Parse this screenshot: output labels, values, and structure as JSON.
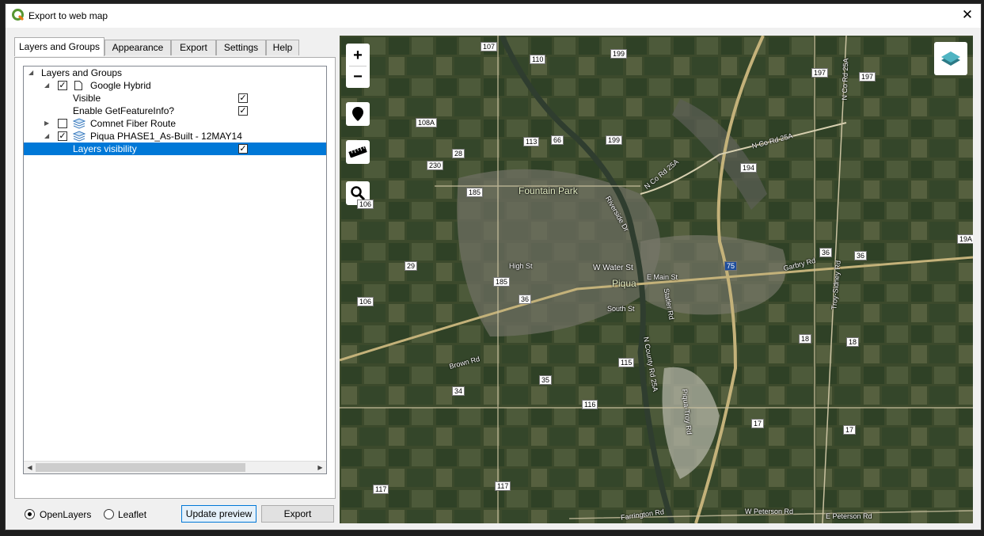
{
  "window": {
    "title": "Export to web map"
  },
  "tabs": [
    "Layers and Groups",
    "Appearance",
    "Export",
    "Settings",
    "Help"
  ],
  "tree": {
    "root": "Layers and Groups",
    "layer1": {
      "name": "Google Hybrid",
      "checked": true,
      "visible_label": "Visible",
      "getfeatureinfo_label": "Enable GetFeatureInfo?"
    },
    "layer2": {
      "name": "Comnet Fiber Route",
      "checked": false
    },
    "layer3": {
      "name": "Piqua PHASE1_As-Built - 12MAY14",
      "checked": true,
      "visibility_label": "Layers visibility"
    }
  },
  "bottom": {
    "openlayers_label": "OpenLayers",
    "leaflet_label": "Leaflet",
    "selected": "OpenLayers",
    "update_preview_label": "Update preview",
    "export_label": "Export"
  },
  "map": {
    "zoom_in": "+",
    "zoom_out": "−",
    "place_labels": [
      "Fountain Park",
      "Piqua"
    ],
    "road_labels": [
      "W Water St",
      "High St",
      "South St",
      "E Main St",
      "Riverside Dr",
      "N Co Rd 25A",
      "N Co Rd 25A",
      "Garbry Rd",
      "Brown Rd",
      "Farrington Rd",
      "W Peterson Rd",
      "E Peterson Rd",
      "Statler Rd",
      "Piqua-Troy Rd",
      "N County Rd 25A",
      "Troy-Sidney Rd",
      "N Co Rd 25A"
    ],
    "route_shields": [
      "107",
      "110",
      "199",
      "197",
      "197",
      "108A",
      "113",
      "66",
      "199",
      "28",
      "230",
      "194",
      "185",
      "106",
      "29",
      "185",
      "36",
      "36",
      "36",
      "75",
      "106",
      "18",
      "18",
      "115",
      "35",
      "34",
      "116",
      "17",
      "17",
      "117",
      "117",
      "19A"
    ]
  },
  "colors": {
    "selection": "#0078d7",
    "map_base": "#3f4a2e"
  }
}
